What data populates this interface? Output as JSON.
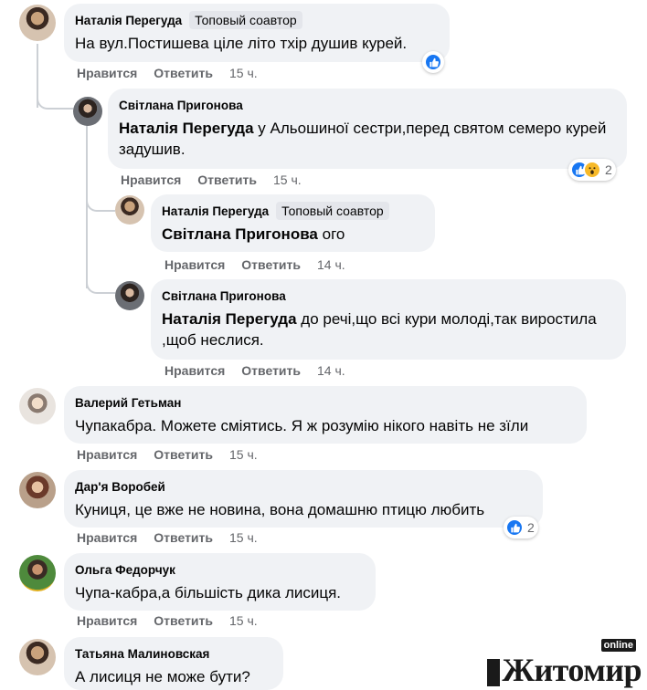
{
  "comments": [
    {
      "author": "Наталія Перегуда",
      "badge": "Топовый соавтор",
      "text": "На вул.Постишева ціле літо тхір душив курей.",
      "actions": {
        "like": "Нравится",
        "reply": "Ответить",
        "time": "15 ч."
      }
    },
    {
      "author": "Світлана Пригонова",
      "mention": "Наталія Перегуда",
      "text": " у Альошиної сестри,перед святом семеро курей задушив.",
      "actions": {
        "like": "Нравится",
        "reply": "Ответить",
        "time": "15 ч."
      },
      "reaction_count": "2"
    },
    {
      "author": "Наталія Перегуда",
      "badge": "Топовый соавтор",
      "mention": "Світлана Пригонова",
      "text": " ого",
      "actions": {
        "like": "Нравится",
        "reply": "Ответить",
        "time": "14 ч."
      }
    },
    {
      "author": "Світлана Пригонова",
      "mention": "Наталія Перегуда",
      "text": " до речі,що всі кури молоді,так виростила ,щоб неслися.",
      "actions": {
        "like": "Нравится",
        "reply": "Ответить",
        "time": "14 ч."
      }
    },
    {
      "author": "Валерий Гетьман",
      "text": "Чупакабра. Можете сміятись. Я ж розумію нікого навіть не зїли",
      "actions": {
        "like": "Нравится",
        "reply": "Ответить",
        "time": "15 ч."
      }
    },
    {
      "author": "Дар'я Воробей",
      "text": "Куниця, це вже не новина, вона домашню птицю любить",
      "actions": {
        "like": "Нравится",
        "reply": "Ответить",
        "time": "15 ч."
      },
      "reaction_count": "2"
    },
    {
      "author": "Ольга Федорчук",
      "text": "Чупа-кабра,а більшість дика лисиця.",
      "actions": {
        "like": "Нравится",
        "reply": "Ответить",
        "time": "15 ч."
      }
    },
    {
      "author": "Татьяна Малиновская",
      "text": "А лисиця не може бути?"
    }
  ],
  "watermark": {
    "text": "Житомир",
    "tag": "online"
  },
  "colors": {
    "bubble": "#f0f2f5",
    "meta": "#65676b",
    "like": "#1877f2",
    "wow": "#f7b928"
  }
}
